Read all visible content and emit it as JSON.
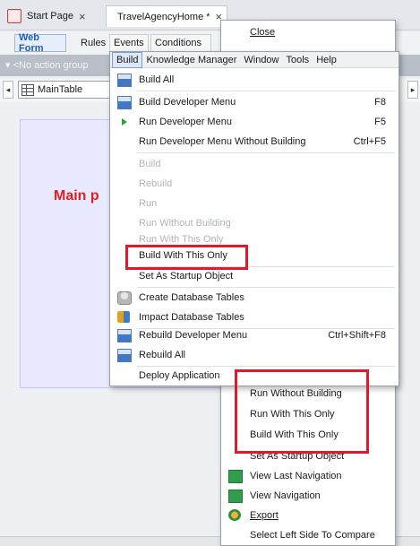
{
  "tabs": [
    {
      "label": "Start Page",
      "close": "×",
      "active": false
    },
    {
      "label": "TravelAgencyHome *",
      "close": "×",
      "active": true
    }
  ],
  "subtabs": [
    "Web Form",
    "Rules",
    "Events",
    "Conditions"
  ],
  "action_bar": "▾ <No action group",
  "nav": {
    "left": "◂",
    "right": "▸",
    "table_label": "MainTable"
  },
  "canvas": {
    "title": "Main p"
  },
  "back_menu": {
    "items": [
      {
        "label": "Close",
        "icon": ""
      },
      {
        "label": "Run Without Building",
        "icon": ""
      },
      {
        "label": "Run With This Only",
        "icon": ""
      },
      {
        "label": "Build With This Only",
        "icon": ""
      },
      {
        "label": "Set As Startup Object",
        "icon": ""
      },
      {
        "label": "View Last Navigation",
        "icon": "navigation-icon"
      },
      {
        "label": "View Navigation",
        "icon": "navigation-icon"
      },
      {
        "label": "Export",
        "icon": "export-icon"
      },
      {
        "label": "Select Left Side To Compare",
        "icon": ""
      }
    ]
  },
  "menubar": [
    "Build",
    "Knowledge Manager",
    "Window",
    "Tools",
    "Help"
  ],
  "build_menu": {
    "items": [
      {
        "label": "Build All",
        "shortcut": "",
        "enabled": true,
        "icon": "build-all-icon"
      },
      {
        "label": "Build Developer Menu",
        "shortcut": "F8",
        "enabled": true,
        "icon": "build-menu-icon"
      },
      {
        "label": "Run Developer Menu",
        "shortcut": "F5",
        "enabled": true,
        "icon": "run-icon"
      },
      {
        "label": "Run Developer Menu Without Building",
        "shortcut": "Ctrl+F5",
        "enabled": true,
        "icon": ""
      },
      {
        "label": "Build",
        "shortcut": "",
        "enabled": false,
        "icon": ""
      },
      {
        "label": "Rebuild",
        "shortcut": "",
        "enabled": false,
        "icon": ""
      },
      {
        "label": "Run",
        "shortcut": "",
        "enabled": false,
        "icon": ""
      },
      {
        "label": "Run Without Building",
        "shortcut": "",
        "enabled": false,
        "icon": ""
      },
      {
        "label": "Run With This Only",
        "shortcut": "",
        "enabled": false,
        "icon": ""
      },
      {
        "label": "Build With This Only",
        "shortcut": "",
        "enabled": true,
        "icon": ""
      },
      {
        "label": "Set As Startup Object",
        "shortcut": "",
        "enabled": true,
        "icon": ""
      },
      {
        "label": "Create Database Tables",
        "shortcut": "",
        "enabled": true,
        "icon": "create-db-icon"
      },
      {
        "label": "Impact Database Tables",
        "shortcut": "",
        "enabled": true,
        "icon": "impact-db-icon"
      },
      {
        "label": "Rebuild Developer Menu",
        "shortcut": "Ctrl+Shift+F8",
        "enabled": true,
        "icon": "rebuild-menu-icon"
      },
      {
        "label": "Rebuild All",
        "shortcut": "",
        "enabled": true,
        "icon": "rebuild-all-icon"
      },
      {
        "label": "Deploy Application",
        "shortcut": "",
        "enabled": true,
        "icon": ""
      }
    ]
  },
  "colors": {
    "highlight": "#e0192b",
    "accent": "#1f5fb3",
    "canvas_title": "#e02020"
  }
}
